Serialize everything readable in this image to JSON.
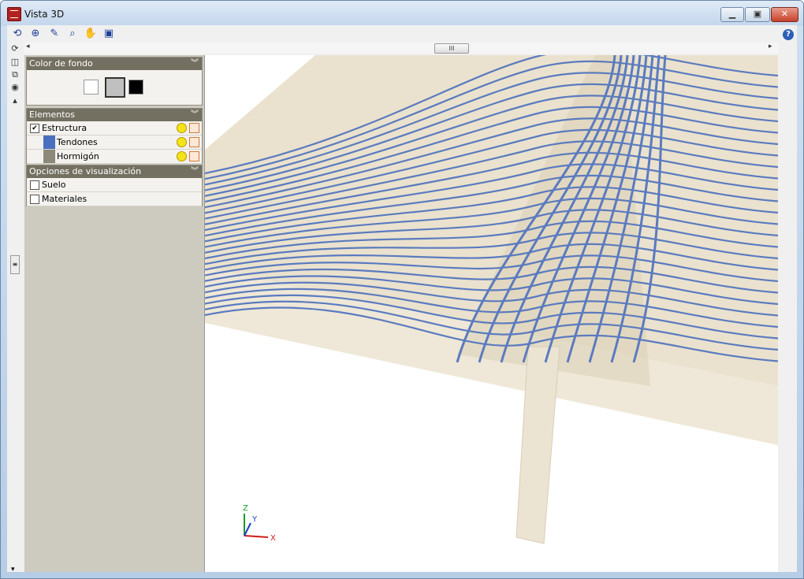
{
  "window": {
    "title": "Vista 3D",
    "min_glyph": "▁",
    "max_glyph": "▣",
    "close_glyph": "✕"
  },
  "toolbar": {
    "icons": [
      "rotate-icon",
      "zoom-extents-icon",
      "pencil-icon",
      "zoom-icon",
      "pan-hand-icon",
      "window-icon"
    ],
    "glyphs": [
      "⟲",
      "⊕",
      "✎",
      "⌕",
      "✋",
      "▣"
    ],
    "help_glyph": "?"
  },
  "scroll": {
    "left_arrow": "◂",
    "right_arrow": "▸",
    "thumb": "III",
    "up_arrow": "▴",
    "down_arrow": "▾",
    "grip": "≡"
  },
  "panels": {
    "background": {
      "header": "Color de fondo",
      "swatches": [
        {
          "name": "white",
          "color": "#ffffff"
        },
        {
          "name": "gray",
          "color": "#c0c0c0"
        },
        {
          "name": "black",
          "color": "#000000"
        }
      ]
    },
    "elements": {
      "header": "Elementos",
      "items": [
        {
          "label": "Estructura",
          "checked": true
        },
        {
          "label": "Tendones",
          "color": "#4a6fbf"
        },
        {
          "label": "Hormigón",
          "color": "#8c887a"
        }
      ]
    },
    "view_options": {
      "header": "Opciones de visualización",
      "items": [
        {
          "label": "Suelo",
          "checked": false
        },
        {
          "label": "Materiales",
          "checked": false
        }
      ]
    }
  },
  "axes": {
    "z": "Z",
    "y": "Y",
    "x": "X"
  },
  "colors": {
    "tendon": "#5b7bbf",
    "concrete": "#e6dcc6",
    "column": "#ece4d2"
  }
}
